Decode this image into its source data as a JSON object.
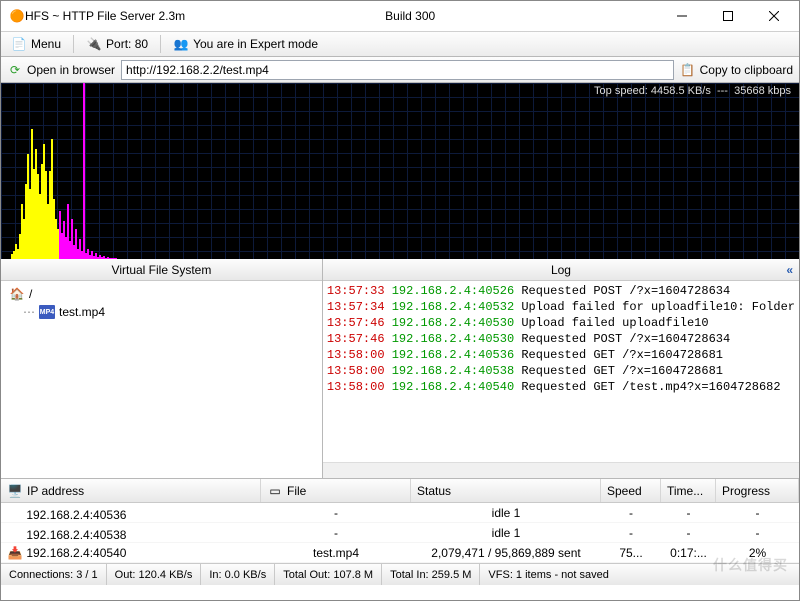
{
  "window": {
    "title": "HFS ~ HTTP File Server 2.3m",
    "build": "Build 300"
  },
  "toolbar": {
    "menu": "Menu",
    "port": "Port: 80",
    "mode": "You are in Expert mode"
  },
  "urlbar": {
    "open": "Open in browser",
    "url": "http://192.168.2.2/test.mp4",
    "copy": "Copy to clipboard"
  },
  "graph": {
    "topspeed": "Top speed: 4458.5 KB/s",
    "kbps": "35668 kbps",
    "sep": "---"
  },
  "panes": {
    "vfs": "Virtual File System",
    "log": "Log"
  },
  "tree": {
    "root": "/",
    "file": "test.mp4"
  },
  "log": [
    {
      "t": "13:57:33",
      "a": "192.168.2.4:40526",
      "m": "Requested POST /?x=1604728634"
    },
    {
      "t": "13:57:34",
      "a": "192.168.2.4:40532",
      "m": "Upload failed for uploadfile10: Folder"
    },
    {
      "t": "13:57:46",
      "a": "192.168.2.4:40530",
      "m": "Upload failed uploadfile10"
    },
    {
      "t": "13:57:46",
      "a": "192.168.2.4:40530",
      "m": "Requested POST /?x=1604728634"
    },
    {
      "t": "13:58:00",
      "a": "192.168.2.4:40536",
      "m": "Requested GET /?x=1604728681"
    },
    {
      "t": "13:58:00",
      "a": "192.168.2.4:40538",
      "m": "Requested GET /?x=1604728681"
    },
    {
      "t": "13:58:00",
      "a": "192.168.2.4:40540",
      "m": "Requested GET /test.mp4?x=1604728682"
    }
  ],
  "conncols": {
    "ip": "IP address",
    "file": "File",
    "status": "Status",
    "speed": "Speed",
    "time": "Time...",
    "progress": "Progress"
  },
  "conns": [
    {
      "ip": "192.168.2.4:40536",
      "file": "-",
      "status": "idle 1",
      "speed": "-",
      "time": "-",
      "prog": "-"
    },
    {
      "ip": "192.168.2.4:40538",
      "file": "-",
      "status": "idle 1",
      "speed": "-",
      "time": "-",
      "prog": "-"
    },
    {
      "ip": "192.168.2.4:40540",
      "file": "test.mp4",
      "status": "2,079,471 / 95,869,889 sent",
      "speed": "75...",
      "time": "0:17:...",
      "prog": "2%"
    }
  ],
  "statusbar": {
    "conns": "Connections: 3 / 1",
    "out": "Out: 120.4 KB/s",
    "in": "In: 0.0 KB/s",
    "totalout": "Total Out: 107.8 M",
    "totalin": "Total In: 259.5 M",
    "vfs": "VFS: 1 items - not saved"
  },
  "watermark": "什么值得买"
}
